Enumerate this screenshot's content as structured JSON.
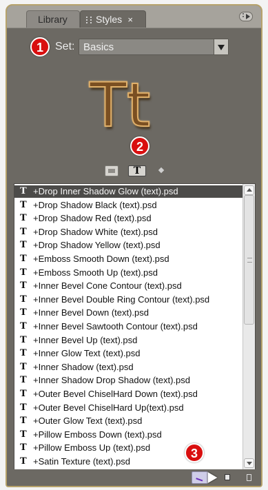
{
  "tabs": {
    "library": "Library",
    "styles": "Styles",
    "close": "×"
  },
  "set": {
    "label": "Set:",
    "value": "Basics"
  },
  "preview": {
    "text": "Tt"
  },
  "callouts": {
    "one": "1",
    "two": "2",
    "three": "3"
  },
  "list": {
    "items": [
      {
        "icon": "T",
        "label": "+Drop Inner Shadow Glow (text).psd",
        "selected": true
      },
      {
        "icon": "T",
        "label": "+Drop Shadow Black (text).psd"
      },
      {
        "icon": "T",
        "label": "+Drop Shadow Red (text).psd"
      },
      {
        "icon": "T",
        "label": "+Drop Shadow White (text).psd"
      },
      {
        "icon": "T",
        "label": "+Drop Shadow Yellow (text).psd"
      },
      {
        "icon": "T",
        "label": "+Emboss Smooth Down (text).psd"
      },
      {
        "icon": "T",
        "label": "+Emboss Smooth Up (text).psd"
      },
      {
        "icon": "T",
        "label": "+Inner Bevel Cone Contour (text).psd"
      },
      {
        "icon": "T",
        "label": "+Inner Bevel Double Ring Contour (text).psd"
      },
      {
        "icon": "T",
        "label": "+Inner Bevel Down (text).psd"
      },
      {
        "icon": "T",
        "label": "+Inner Bevel Sawtooth Contour (text).psd"
      },
      {
        "icon": "T",
        "label": "+Inner Bevel Up (text).psd"
      },
      {
        "icon": "T",
        "label": "+Inner Glow Text (text).psd"
      },
      {
        "icon": "T",
        "label": "+Inner Shadow (text).psd"
      },
      {
        "icon": "T",
        "label": "+Inner Shadow Drop Shadow (text).psd"
      },
      {
        "icon": "T",
        "label": "+Outer Bevel ChiselHard Down (text).psd"
      },
      {
        "icon": "T",
        "label": "+Outer Bevel ChiselHard Up(text).psd"
      },
      {
        "icon": "T",
        "label": "+Outer Glow Text (text).psd"
      },
      {
        "icon": "T",
        "label": "+Pillow Emboss Down (text).psd"
      },
      {
        "icon": "T",
        "label": "+Pillow Emboss Up (text).psd"
      },
      {
        "icon": "T",
        "label": "+Satin Texture (text).psd"
      }
    ]
  },
  "icons": {
    "panel_menu": "panel-menu-icon",
    "dropdown": "chevron-down-icon",
    "view_thumbnail": "thumbnail-view-icon",
    "view_text": "text-view-icon",
    "view_small": "small-view-icon",
    "apply": "apply-style-icon",
    "new": "new-style-icon",
    "delete": "delete-style-icon"
  },
  "colors": {
    "panel_bg": "#6c6963",
    "border_gold": "#b7a36b",
    "callout_red": "#d90f0f",
    "selected_row": "#4c4b49"
  }
}
